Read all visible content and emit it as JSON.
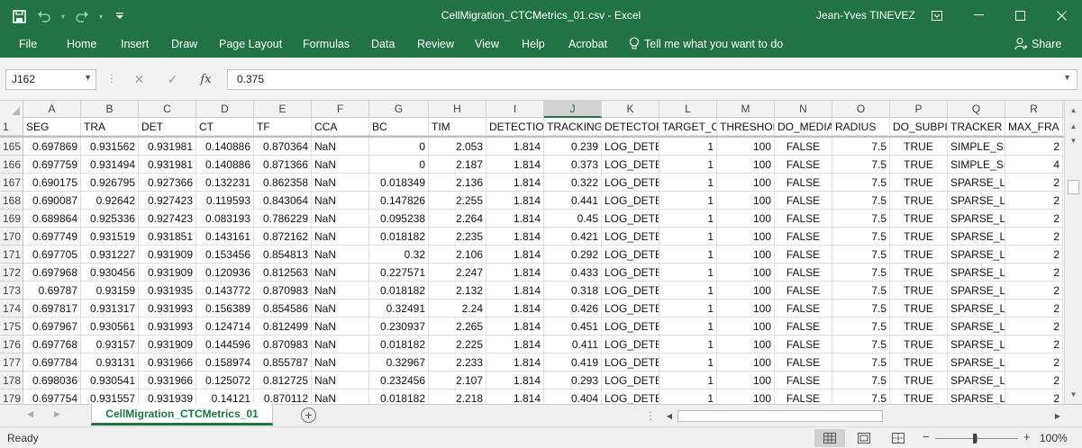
{
  "window": {
    "title": "CellMigration_CTCMetrics_01.csv  -  Excel",
    "user": "Jean-Yves TINEVEZ"
  },
  "quick_access": [
    "save-icon",
    "undo-icon",
    "redo-icon",
    "customize-icon"
  ],
  "ribbon": {
    "tabs": [
      "File",
      "Home",
      "Insert",
      "Draw",
      "Page Layout",
      "Formulas",
      "Data",
      "Review",
      "View",
      "Help",
      "Acrobat"
    ],
    "tell_me": "Tell me what you want to do",
    "share": "Share"
  },
  "formula_bar": {
    "name_box": "J162",
    "formula": "0.375"
  },
  "grid": {
    "columns": [
      "A",
      "B",
      "C",
      "D",
      "E",
      "F",
      "G",
      "H",
      "I",
      "J",
      "K",
      "L",
      "M",
      "N",
      "O",
      "P",
      "Q",
      "R"
    ],
    "selected_column": "J",
    "header_row": {
      "number": "1",
      "cells": [
        "SEG",
        "TRA",
        "DET",
        "CT",
        "TF",
        "CCA",
        "BC",
        "TIM",
        "DETECTIO",
        "TRACKING",
        "DETECTOR",
        "TARGET_C",
        "THRESHOL",
        "DO_MEDIA",
        "RADIUS",
        "DO_SUBPI",
        "TRACKER",
        "MAX_FRA"
      ]
    },
    "rows": [
      {
        "n": "165",
        "c": [
          "0.697869",
          "0.931562",
          "0.931981",
          "0.140886",
          "0.870364",
          "NaN",
          "0",
          "2.053",
          "1.814",
          "0.239",
          "LOG_DETE",
          "1",
          "100",
          "FALSE",
          "7.5",
          "TRUE",
          "SIMPLE_SI",
          "2"
        ]
      },
      {
        "n": "166",
        "c": [
          "0.697759",
          "0.931494",
          "0.931981",
          "0.140886",
          "0.871366",
          "NaN",
          "0",
          "2.187",
          "1.814",
          "0.373",
          "LOG_DETE",
          "1",
          "100",
          "FALSE",
          "7.5",
          "TRUE",
          "SIMPLE_SI",
          "4"
        ]
      },
      {
        "n": "167",
        "c": [
          "0.690175",
          "0.926795",
          "0.927366",
          "0.132231",
          "0.862358",
          "NaN",
          "0.018349",
          "2.136",
          "1.814",
          "0.322",
          "LOG_DETE",
          "1",
          "100",
          "FALSE",
          "7.5",
          "TRUE",
          "SPARSE_LA",
          "2"
        ]
      },
      {
        "n": "168",
        "c": [
          "0.690087",
          "0.92642",
          "0.927423",
          "0.119593",
          "0.843064",
          "NaN",
          "0.147826",
          "2.255",
          "1.814",
          "0.441",
          "LOG_DETE",
          "1",
          "100",
          "FALSE",
          "7.5",
          "TRUE",
          "SPARSE_LA",
          "2"
        ]
      },
      {
        "n": "169",
        "c": [
          "0.689864",
          "0.925336",
          "0.927423",
          "0.083193",
          "0.786229",
          "NaN",
          "0.095238",
          "2.264",
          "1.814",
          "0.45",
          "LOG_DETE",
          "1",
          "100",
          "FALSE",
          "7.5",
          "TRUE",
          "SPARSE_LA",
          "2"
        ]
      },
      {
        "n": "170",
        "c": [
          "0.697749",
          "0.931519",
          "0.931851",
          "0.143161",
          "0.872162",
          "NaN",
          "0.018182",
          "2.235",
          "1.814",
          "0.421",
          "LOG_DETE",
          "1",
          "100",
          "FALSE",
          "7.5",
          "TRUE",
          "SPARSE_LA",
          "2"
        ]
      },
      {
        "n": "171",
        "c": [
          "0.697705",
          "0.931227",
          "0.931909",
          "0.153456",
          "0.854813",
          "NaN",
          "0.32",
          "2.106",
          "1.814",
          "0.292",
          "LOG_DETE",
          "1",
          "100",
          "FALSE",
          "7.5",
          "TRUE",
          "SPARSE_LA",
          "2"
        ]
      },
      {
        "n": "172",
        "c": [
          "0.697968",
          "0.930456",
          "0.931909",
          "0.120936",
          "0.812563",
          "NaN",
          "0.227571",
          "2.247",
          "1.814",
          "0.433",
          "LOG_DETE",
          "1",
          "100",
          "FALSE",
          "7.5",
          "TRUE",
          "SPARSE_LA",
          "2"
        ]
      },
      {
        "n": "173",
        "c": [
          "0.69787",
          "0.93159",
          "0.931935",
          "0.143772",
          "0.870983",
          "NaN",
          "0.018182",
          "2.132",
          "1.814",
          "0.318",
          "LOG_DETE",
          "1",
          "100",
          "FALSE",
          "7.5",
          "TRUE",
          "SPARSE_LA",
          "2"
        ]
      },
      {
        "n": "174",
        "c": [
          "0.697817",
          "0.931317",
          "0.931993",
          "0.156389",
          "0.854586",
          "NaN",
          "0.32491",
          "2.24",
          "1.814",
          "0.426",
          "LOG_DETE",
          "1",
          "100",
          "FALSE",
          "7.5",
          "TRUE",
          "SPARSE_LA",
          "2"
        ]
      },
      {
        "n": "175",
        "c": [
          "0.697967",
          "0.930561",
          "0.931993",
          "0.124714",
          "0.812499",
          "NaN",
          "0.230937",
          "2.265",
          "1.814",
          "0.451",
          "LOG_DETE",
          "1",
          "100",
          "FALSE",
          "7.5",
          "TRUE",
          "SPARSE_LA",
          "2"
        ]
      },
      {
        "n": "176",
        "c": [
          "0.697768",
          "0.93157",
          "0.931909",
          "0.144596",
          "0.870983",
          "NaN",
          "0.018182",
          "2.225",
          "1.814",
          "0.411",
          "LOG_DETE",
          "1",
          "100",
          "FALSE",
          "7.5",
          "TRUE",
          "SPARSE_LA",
          "2"
        ]
      },
      {
        "n": "177",
        "c": [
          "0.697784",
          "0.93131",
          "0.931966",
          "0.158974",
          "0.855787",
          "NaN",
          "0.32967",
          "2.233",
          "1.814",
          "0.419",
          "LOG_DETE",
          "1",
          "100",
          "FALSE",
          "7.5",
          "TRUE",
          "SPARSE_LA",
          "2"
        ]
      },
      {
        "n": "178",
        "c": [
          "0.698036",
          "0.930541",
          "0.931966",
          "0.125072",
          "0.812725",
          "NaN",
          "0.232456",
          "2.107",
          "1.814",
          "0.293",
          "LOG_DETE",
          "1",
          "100",
          "FALSE",
          "7.5",
          "TRUE",
          "SPARSE_LA",
          "2"
        ]
      },
      {
        "n": "179",
        "c": [
          "0.697754",
          "0.931557",
          "0.931939",
          "0.14121",
          "0.870112",
          "NaN",
          "0.018182",
          "2.218",
          "1.814",
          "0.404",
          "LOG_DETE",
          "1",
          "100",
          "FALSE",
          "7.5",
          "TRUE",
          "SPARSE_LA",
          "2"
        ]
      }
    ]
  },
  "sheets": {
    "active": "CellMigration_CTCMetrics_01"
  },
  "status_bar": {
    "status": "Ready",
    "zoom": "100%",
    "views": [
      "normal-view-icon",
      "page-layout-view-icon",
      "page-break-view-icon"
    ]
  },
  "colors": {
    "accent": "#217346"
  }
}
